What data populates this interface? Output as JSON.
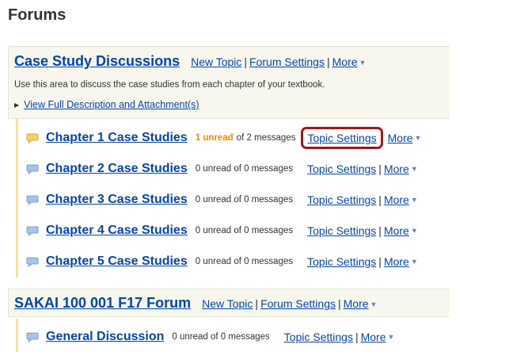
{
  "page": {
    "title": "Forums"
  },
  "forums": [
    {
      "title": "Case Study Discussions",
      "new_topic": "New Topic",
      "settings": "Forum Settings",
      "more": "More",
      "description": "Use this area to discuss the case studies from each chapter of your textbook.",
      "view_full": "View Full Description and Attachment(s)",
      "topics": [
        {
          "title": "Chapter 1 Case Studies",
          "unread": "1 unread",
          "count": "of 2 messages",
          "settings": "Topic Settings",
          "more": "More",
          "has_unread": true
        },
        {
          "title": "Chapter 2 Case Studies",
          "count": "0 unread of 0 messages",
          "settings": "Topic Settings",
          "more": "More"
        },
        {
          "title": "Chapter 3 Case Studies",
          "count": "0 unread of 0 messages",
          "settings": "Topic Settings",
          "more": "More"
        },
        {
          "title": "Chapter 4 Case Studies",
          "count": "0 unread of 0 messages",
          "settings": "Topic Settings",
          "more": "More"
        },
        {
          "title": "Chapter 5 Case Studies",
          "count": "0 unread of 0 messages",
          "settings": "Topic Settings",
          "more": "More"
        }
      ]
    },
    {
      "title": "SAKAI 100 001 F17 Forum",
      "new_topic": "New Topic",
      "settings": "Forum Settings",
      "more": "More",
      "topics": [
        {
          "title": "General Discussion",
          "count": "0 unread of 0 messages",
          "settings": "Topic Settings",
          "more": "More"
        }
      ]
    }
  ],
  "colors": {
    "link": "#0645ad",
    "unread": "#f08d00",
    "highlight": "#a51616",
    "header_bg": "#f7f7ee",
    "topic_bar": "#f3e2a4"
  },
  "icons": {
    "topic_unread": "chat-bubble-yellow-icon",
    "topic_read": "chat-bubble-blue-icon",
    "more": "caret-down-icon",
    "expand": "triangle-right-icon"
  }
}
